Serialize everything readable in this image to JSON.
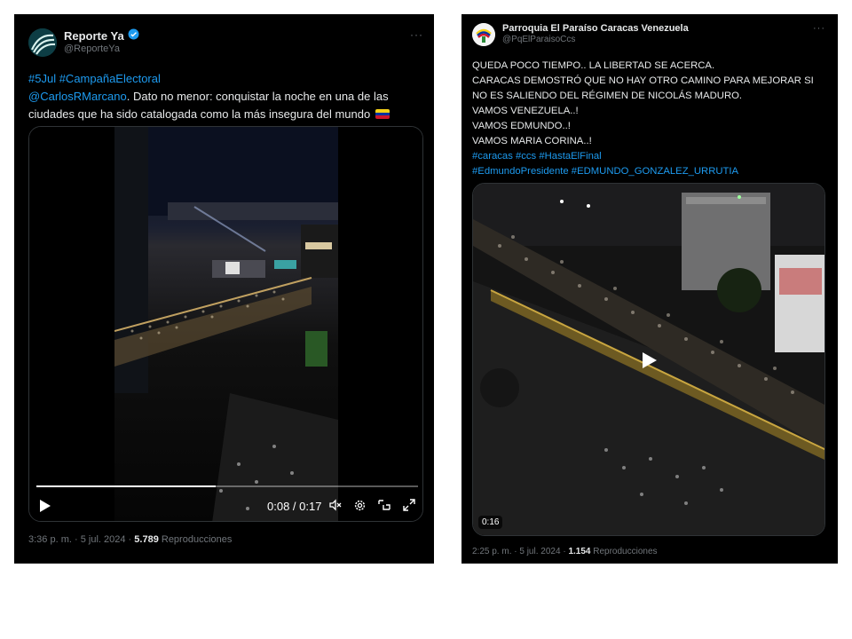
{
  "tweet1": {
    "name": "Reporte Ya",
    "handle": "@ReporteYa",
    "more": "···",
    "hashtag1": "#5Jul",
    "hashtag2": "#CampañaElectoral",
    "mention": "@CarlosRMarcano",
    "text_after_mention": ". Dato no menor: conquistar la noche en una de las",
    "text_line2": "ciudades que ha sido catalogada como la más insegura del mundo",
    "flag_icon": "venezuela-flag-icon",
    "video": {
      "time": "0:08 / 0:17",
      "progress": 0.47
    },
    "footer": {
      "time": "3:36 p. m.",
      "sep1": "·",
      "date": "5 jul. 2024",
      "sep2": "·",
      "views": "5.789",
      "views_label": "Reproducciones"
    }
  },
  "tweet2": {
    "name": "Parroquia El Paraíso Caracas Venezuela",
    "handle": "@PqElParaisoCcs",
    "more": "···",
    "lines": [
      "QUEDA POCO TIEMPO.. LA LIBERTAD SE ACERCA.",
      "CARACAS DEMOSTRÓ QUE NO HAY OTRO CAMINO PARA MEJORAR SI",
      "NO ES SALIENDO DEL RÉGIMEN DE NICOLÁS MADURO.",
      "VAMOS VENEZUELA..!",
      "VAMOS EDMUNDO..!",
      "VAMOS MARIA CORINA..!"
    ],
    "tags_line1": "#caracas #ccs #HastaElFinal",
    "tags_line2": "#EdmundoPresidente #EDMUNDO_GONZALEZ_URRUTIA",
    "video": {
      "duration": "0:16"
    },
    "footer": {
      "time": "2:25 p. m.",
      "sep1": "·",
      "date": "5 jul. 2024",
      "sep2": "·",
      "views": "1.154",
      "views_label": "Reproducciones"
    }
  },
  "colors": {
    "background": "#000000",
    "text": "#e7e9ea",
    "muted": "#71767b",
    "link": "#1d9bf0",
    "verified": "#1d9bf0"
  }
}
